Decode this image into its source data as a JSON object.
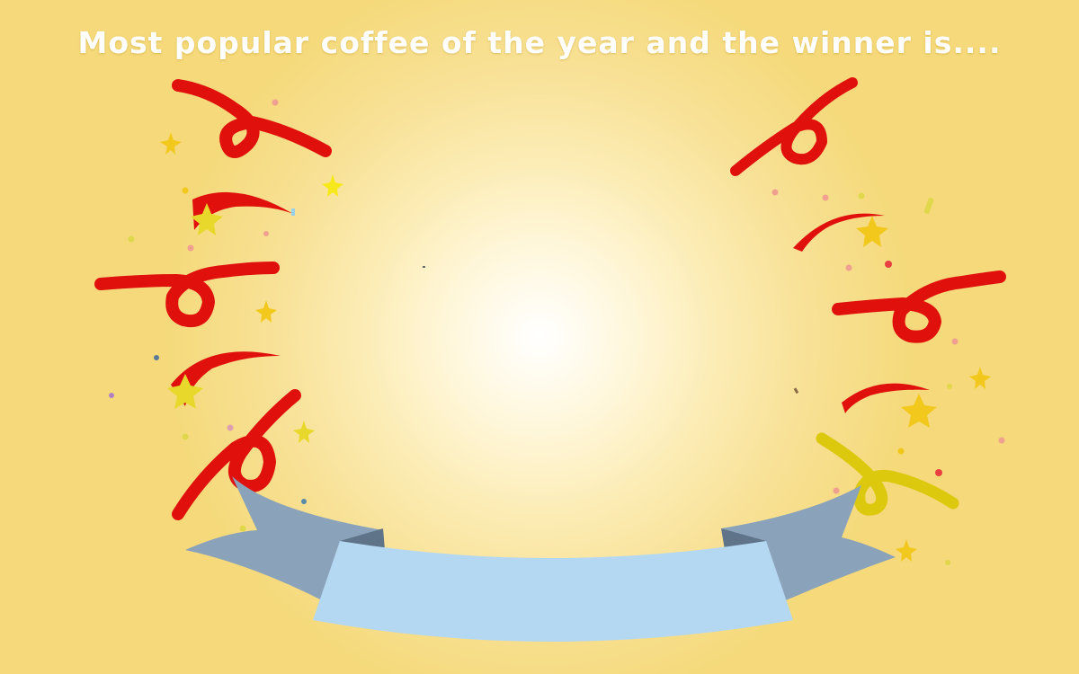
{
  "headline": "Most popular coffee of the year and the winner is....",
  "banner_text": "",
  "colors": {
    "background": "#f5d97a",
    "glow_center": "#ffffff",
    "streamer_red": "#e0100c",
    "streamer_yellow": "#dcc90e",
    "star_yellow": "#f2c81c",
    "banner_front": "#b5d8f2",
    "banner_back": "#8aa3ba",
    "banner_fold": "#5f7488",
    "headline_text": "#ffffff"
  },
  "icons": [
    "confetti-streamer",
    "star-icon",
    "confetti-dot",
    "ribbon-banner"
  ]
}
